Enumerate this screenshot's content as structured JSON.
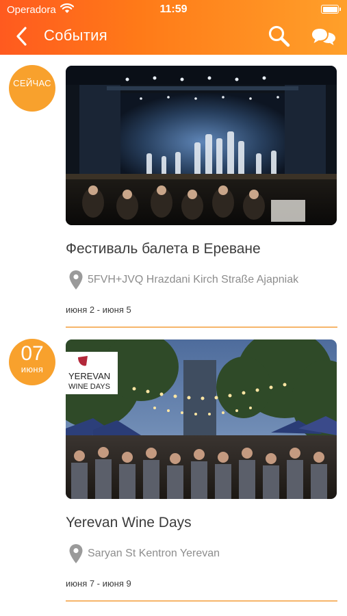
{
  "status_bar": {
    "carrier": "Operadora",
    "time": "11:59"
  },
  "nav": {
    "title": "События",
    "back_icon": "chevron-left-icon",
    "search_icon": "search-icon",
    "chat_icon": "chat-bubbles-icon"
  },
  "colors": {
    "header_start": "#ff5a1f",
    "header_end": "#ffa02a",
    "badge": "#f8a12d",
    "divider": "#f6b56a"
  },
  "events": [
    {
      "badge_text": "СЕЙЧАС",
      "title": "Фестиваль балета в Ереване",
      "location": "5FVH+JVQ Hrazdani Kirch Straße Ajapniak",
      "dates": "июня 2 - июня 5"
    },
    {
      "badge_day": "07",
      "badge_month": "июня",
      "title": "Yerevan Wine Days",
      "location": "Saryan St Kentron Yerevan",
      "dates": "июня 7 - июня 9",
      "logo_text": [
        "YEREVAN",
        "WINE DAYS"
      ]
    }
  ]
}
